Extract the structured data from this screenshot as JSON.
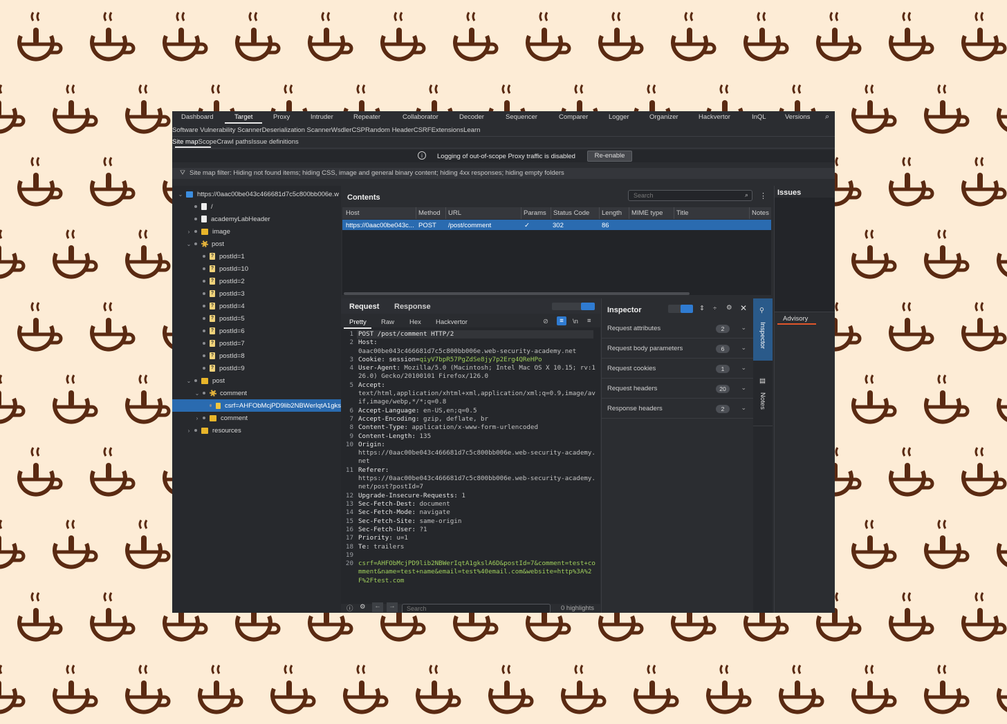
{
  "top_tabs": [
    "Dashboard",
    "Target",
    "Proxy",
    "Intruder",
    "Repeater",
    "Collaborator",
    "Decoder",
    "Sequencer",
    "Comparer",
    "Logger",
    "Organizer",
    "Hackvertor",
    "InQL",
    "Versions"
  ],
  "ext_tabs": [
    "Software Vulnerability Scanner",
    "Deserialization Scanner",
    "Wsdler",
    "CSP",
    "Random Header",
    "CSRF",
    "Extensions",
    "Learn"
  ],
  "sub_tabs": [
    "Site map",
    "Scope",
    "Crawl paths",
    "Issue definitions"
  ],
  "notice": {
    "text": "Logging of out-of-scope Proxy traffic is disabled",
    "button": "Re-enable"
  },
  "filter": "Site map filter: Hiding not found items; hiding CSS, image and general binary content; hiding 4xx responses; hiding empty folders",
  "tree": [
    {
      "label": "https://0aac00be043c466681d7c5c800bb006e.w"
    },
    {
      "label": "/"
    },
    {
      "label": "academyLabHeader"
    },
    {
      "label": "image"
    },
    {
      "label": "post"
    },
    {
      "label": "postId=1"
    },
    {
      "label": "postId=10"
    },
    {
      "label": "postId=2"
    },
    {
      "label": "postId=3"
    },
    {
      "label": "postId=4"
    },
    {
      "label": "postId=5"
    },
    {
      "label": "postId=6"
    },
    {
      "label": "postId=7"
    },
    {
      "label": "postId=8"
    },
    {
      "label": "postId=9"
    },
    {
      "label": "post"
    },
    {
      "label": "comment"
    },
    {
      "label": "csrf=AHFObMcjPD9lib2NBWerIqtA1gks"
    },
    {
      "label": "comment"
    },
    {
      "label": "resources"
    }
  ],
  "contents": {
    "title": "Contents",
    "search_placeholder": "Search",
    "columns": [
      "Host",
      "Method",
      "URL",
      "Params",
      "Status Code",
      "Length",
      "MIME type",
      "Title",
      "Notes"
    ],
    "row": {
      "host": "https://0aac00be043c...",
      "method": "POST",
      "url": "/post/comment",
      "params": "✓",
      "status": "302",
      "length": "86"
    }
  },
  "issues": {
    "title": "Issues",
    "advisory": "Advisory"
  },
  "editor": {
    "tabs": [
      "Request",
      "Response"
    ],
    "subtabs": [
      "Pretty",
      "Raw",
      "Hex",
      "Hackvertor"
    ],
    "newline_label": "\\n",
    "search_placeholder": "Search",
    "highlights": "0 highlights",
    "lines": [
      {
        "n": "1",
        "k": "POST /post/comment HTTP/2",
        "v": ""
      },
      {
        "n": "2",
        "k": "Host:",
        "v": "\n0aac00be043c466681d7c5c800bb006e.web-security-academy.net"
      },
      {
        "n": "3",
        "k": "Cookie: session=",
        "v": "qiyV7bpR57PgZdSe8jy7p2Erg4QReHPo",
        "green": true
      },
      {
        "n": "4",
        "k": "User-Agent:",
        "v": " Mozilla/5.0 (Macintosh; Intel Mac OS X 10.15; rv:126.0) Gecko/20100101 Firefox/126.0"
      },
      {
        "n": "5",
        "k": "Accept:",
        "v": "\ntext/html,application/xhtml+xml,application/xml;q=0.9,image/avif,image/webp,*/*;q=0.8"
      },
      {
        "n": "6",
        "k": "Accept-Language:",
        "v": " en-US,en;q=0.5"
      },
      {
        "n": "7",
        "k": "Accept-Encoding:",
        "v": " gzip, deflate, br"
      },
      {
        "n": "8",
        "k": "Content-Type:",
        "v": " application/x-www-form-urlencoded"
      },
      {
        "n": "9",
        "k": "Content-Length:",
        "v": " 135"
      },
      {
        "n": "10",
        "k": "Origin:",
        "v": "\nhttps://0aac00be043c466681d7c5c800bb006e.web-security-academy.net"
      },
      {
        "n": "11",
        "k": "Referer:",
        "v": "\nhttps://0aac00be043c466681d7c5c800bb006e.web-security-academy.net/post?postId=7"
      },
      {
        "n": "12",
        "k": "Upgrade-Insecure-Requests:",
        "v": " 1"
      },
      {
        "n": "13",
        "k": "Sec-Fetch-Dest:",
        "v": " document"
      },
      {
        "n": "14",
        "k": "Sec-Fetch-Mode:",
        "v": " navigate"
      },
      {
        "n": "15",
        "k": "Sec-Fetch-Site:",
        "v": " same-origin"
      },
      {
        "n": "16",
        "k": "Sec-Fetch-User:",
        "v": " ?1"
      },
      {
        "n": "17",
        "k": "Priority:",
        "v": " u=1"
      },
      {
        "n": "18",
        "k": "Te:",
        "v": " trailers"
      },
      {
        "n": "19",
        "k": "",
        "v": ""
      },
      {
        "n": "20",
        "k": "",
        "v": "csrf=AHFObMcjPD9lib2NBWerIqtA1gkslA6D&postId=7&comment=test+comment&name=test+name&email=test%40email.com&website=http%3A%2F%2Ftest.com",
        "body": true
      }
    ]
  },
  "inspector": {
    "title": "Inspector",
    "rows": [
      {
        "label": "Request attributes",
        "count": "2"
      },
      {
        "label": "Request body parameters",
        "count": "6"
      },
      {
        "label": "Request cookies",
        "count": "1"
      },
      {
        "label": "Request headers",
        "count": "20"
      },
      {
        "label": "Response headers",
        "count": "2"
      }
    ],
    "vtabs": [
      "Inspector",
      "Notes"
    ]
  },
  "colors": {
    "accent": "#e8b52a",
    "selection": "#2a6bb0",
    "logo": "#5a2a12",
    "background": "#fdecd6"
  },
  "icons": [
    "coffee-cup-icon",
    "search-icon",
    "info-icon",
    "filter-icon",
    "folder-icon",
    "file-icon",
    "gear-icon",
    "close-icon",
    "help-icon",
    "settings-icon"
  ]
}
